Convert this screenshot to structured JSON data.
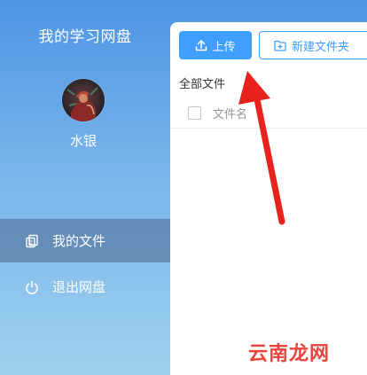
{
  "sidebar": {
    "app_title": "我的学习网盘",
    "user": {
      "name": "水银",
      "avatar_icon": "avatar-image"
    },
    "nav": [
      {
        "label": "我的文件",
        "icon": "files-icon",
        "active": true
      },
      {
        "label": "退出网盘",
        "icon": "power-icon",
        "active": false
      }
    ]
  },
  "toolbar": {
    "upload_label": "上传",
    "upload_icon": "upload-icon",
    "new_folder_label": "新建文件夹",
    "new_folder_icon": "folder-plus-icon"
  },
  "breadcrumb": "全部文件",
  "table": {
    "columns": [
      "文件名"
    ],
    "rows": []
  },
  "annotation": {
    "type": "red-arrow",
    "color": "#e8231d"
  },
  "watermark": "云南龙网",
  "colors": {
    "primary": "#409eff",
    "sidebar_gradient_top": "#4d95e3",
    "sidebar_gradient_bottom": "#9ed0ee",
    "annotation_red": "#e8231d"
  }
}
